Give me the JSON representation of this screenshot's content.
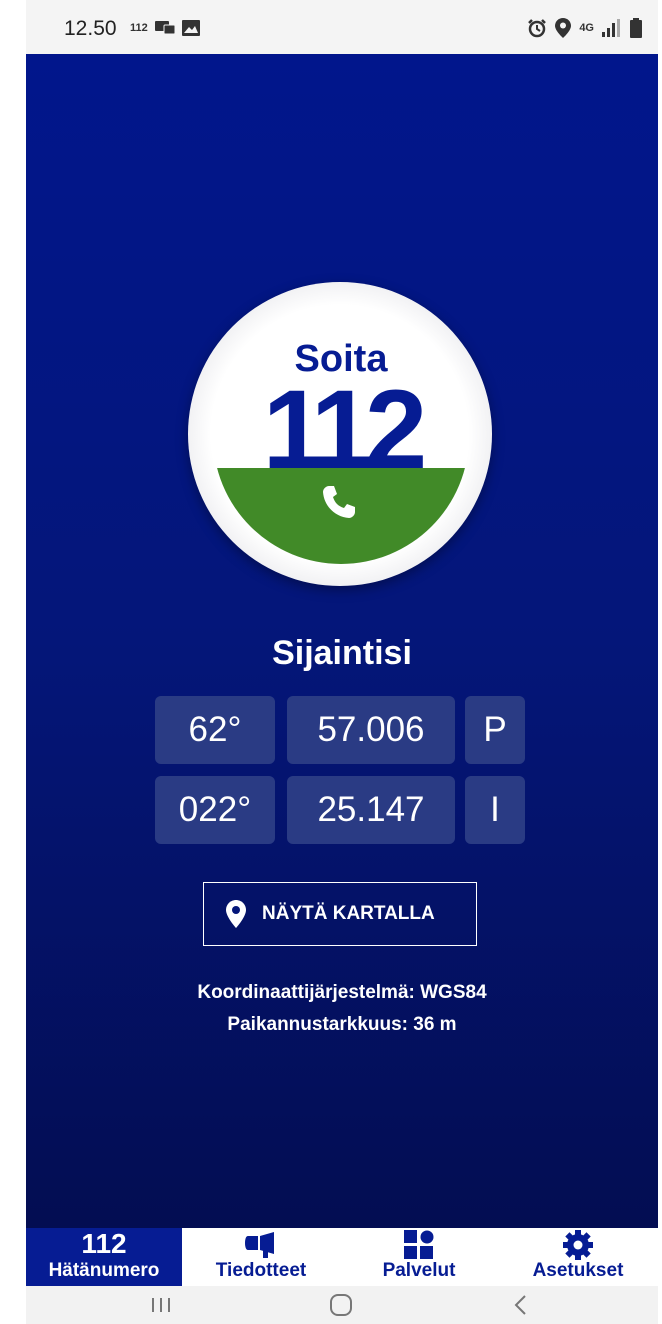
{
  "status_bar": {
    "time": "12.50",
    "left_icons": [
      "112-badge-icon",
      "message-icon",
      "image-icon"
    ],
    "small_112": "112",
    "right_icons": [
      "alarm-icon",
      "location-icon",
      "4g-icon",
      "signal-icon",
      "battery-icon"
    ],
    "network": "4G"
  },
  "call_button": {
    "label": "Soita",
    "number": "112",
    "icon": "phone-icon",
    "accent_blue": "#061c93",
    "accent_green": "#418a28"
  },
  "location": {
    "title": "Sijaintisi",
    "latitude": {
      "degrees": "62°",
      "minutes": "57.006",
      "hemisphere": "P"
    },
    "longitude": {
      "degrees": "022°",
      "minutes": "25.147",
      "hemisphere": "I"
    },
    "map_button_label": "NÄYTÄ KARTALLA",
    "coordinate_system": "Koordinaattijärjestelmä: WGS84",
    "accuracy": "Paikannustarkkuus: 36 m"
  },
  "bottom_nav": {
    "items": [
      {
        "label": "Hätänumero",
        "icon_text": "112",
        "active": true
      },
      {
        "label": "Tiedotteet",
        "icon": "megaphone-icon",
        "active": false
      },
      {
        "label": "Palvelut",
        "icon": "grid-icon",
        "active": false
      },
      {
        "label": "Asetukset",
        "icon": "gear-icon",
        "active": false
      }
    ]
  },
  "system_nav": [
    "recents-icon",
    "home-icon",
    "back-icon"
  ]
}
